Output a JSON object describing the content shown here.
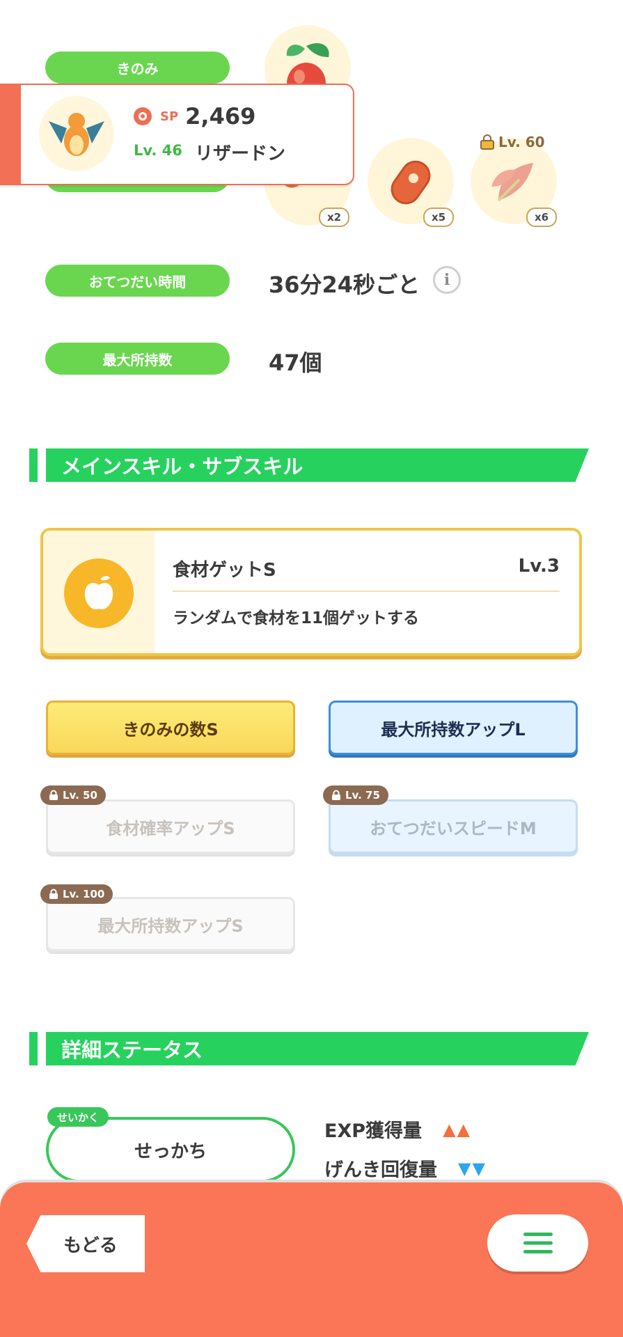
{
  "production": {
    "berry_label": "きのみ",
    "ingredient_quantities": [
      "x2",
      "x5",
      "x6"
    ],
    "locked_ingredient_level": "Lv. 60"
  },
  "pokemon": {
    "sp_label": "SP",
    "sp_value": "2,469",
    "level": "Lv. 46",
    "name": "リザードン"
  },
  "help_time": {
    "label": "おてつだい時間",
    "value": "36分24秒ごと"
  },
  "max_carry": {
    "label": "最大所持数",
    "value": "47個"
  },
  "skills_section": {
    "title": "メインスキル・サブスキル"
  },
  "main_skill": {
    "name": "食材ゲットS",
    "level": "Lv.3",
    "description": "ランダムで食材を11個ゲットする"
  },
  "sub_skills": [
    {
      "label": "きのみの数S",
      "lock": ""
    },
    {
      "label": "最大所持数アップL",
      "lock": ""
    },
    {
      "label": "食材確率アップS",
      "lock": "Lv. 50"
    },
    {
      "label": "おてつだいスピードM",
      "lock": "Lv. 75"
    },
    {
      "label": "最大所持数アップS",
      "lock": "Lv. 100"
    }
  ],
  "status_section": {
    "title": "詳細ステータス"
  },
  "nature": {
    "tag": "せいかく",
    "value": "せっかち",
    "stats": [
      {
        "label": "EXP獲得量",
        "arrows": "▲▲",
        "color": "#f2703f"
      },
      {
        "label": "げんき回復量",
        "arrows": "▼▼",
        "color": "#2aa6f0"
      }
    ]
  },
  "nav": {
    "back_label": "もどる"
  },
  "colors": {
    "accent_green": "#27d15e",
    "pill_green": "#6ad64f",
    "bottom_bar": "#fb7656",
    "skill_gold": "#efc54a"
  }
}
